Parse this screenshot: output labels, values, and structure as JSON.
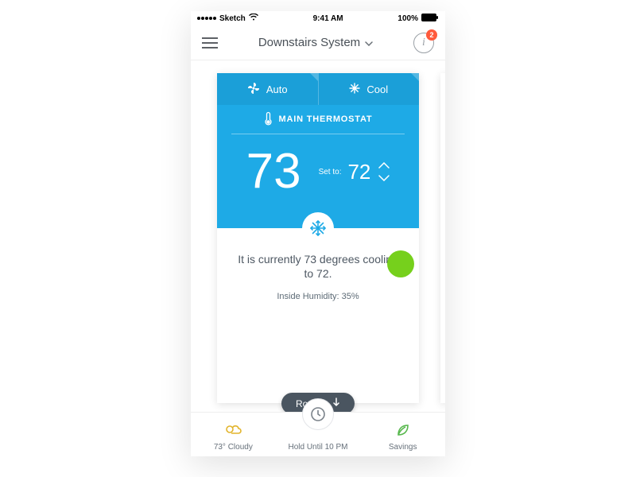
{
  "status_bar": {
    "carrier": "Sketch",
    "time": "9:41 AM",
    "battery": "100%"
  },
  "nav": {
    "title": "Downstairs System",
    "badge_count": "2"
  },
  "thermostat": {
    "tabs": {
      "fan": "Auto",
      "mode": "Cool"
    },
    "location_label": "MAIN THERMOSTAT",
    "current_temp": "73",
    "set_label": "Set to:",
    "set_temp": "72",
    "summary": "It is currently 73 degrees cooling to 72.",
    "humidity": "Inside Humidity: 35%",
    "rooms_button": "Rooms"
  },
  "bottom": {
    "weather": "73° Cloudy",
    "hold": "Hold Until 10 PM",
    "savings": "Savings"
  }
}
